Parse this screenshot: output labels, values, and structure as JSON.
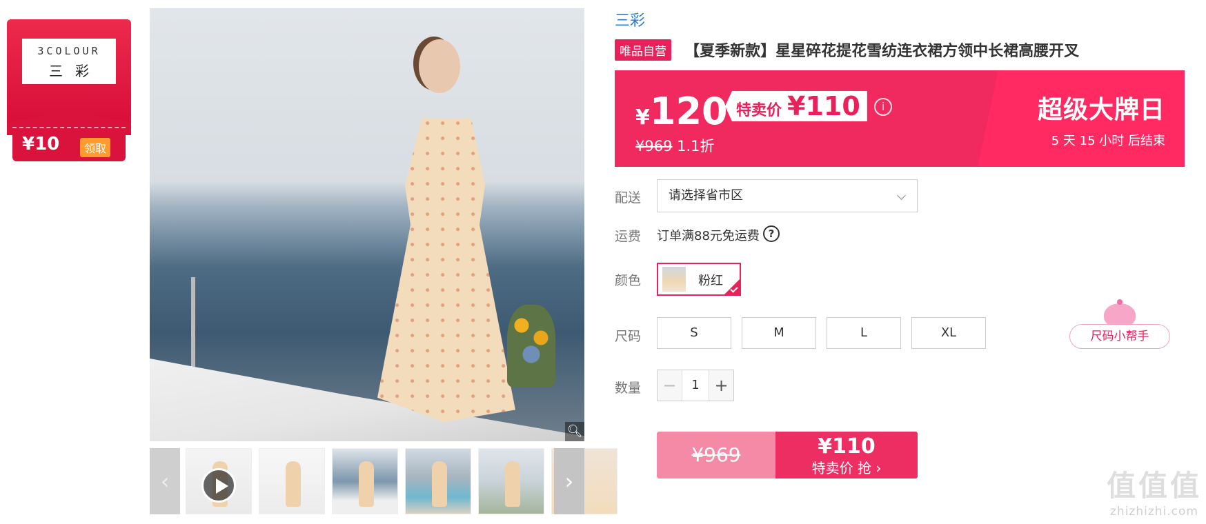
{
  "coupon": {
    "brand_en": "3COLOUR",
    "brand_cn": "三彩",
    "value": "¥10",
    "claim_label": "领取"
  },
  "gallery": {
    "zoom_icon": "magnifier-icon",
    "thumbnails": [
      "video",
      "photo",
      "photo",
      "photo",
      "photo",
      "photo"
    ],
    "prev_icon": "chevron-left-icon",
    "next_icon": "chevron-right-icon"
  },
  "product": {
    "brand": "三彩",
    "self_tag": "唯品自营",
    "title": "【夏季新款】星星碎花提花雪纺连衣裙方领中长裙高腰开叉"
  },
  "price": {
    "currency": "¥",
    "current": "120",
    "sale_label": "特卖价",
    "sale_value": "¥110",
    "original": "¥969",
    "discount": "1.1折",
    "event_title": "超级大牌日",
    "countdown": "5  天 15 小时 后结束",
    "accent_color": "#f0295f"
  },
  "delivery": {
    "label": "配送",
    "placeholder": "请选择省市区"
  },
  "shipping": {
    "label": "运费",
    "text": "订单满88元免运费"
  },
  "color": {
    "label": "颜色",
    "selected": "粉红"
  },
  "size": {
    "label": "尺码",
    "options": [
      "S",
      "M",
      "L",
      "XL"
    ],
    "helper": "尺码小帮手"
  },
  "quantity": {
    "label": "数量",
    "minus": "−",
    "value": "1",
    "plus": "+"
  },
  "buy": {
    "original": "¥969",
    "price": "¥110",
    "action": "特卖价 抢 ›"
  },
  "watermark": {
    "logo": "值值值",
    "url": "zhizhizhi.com"
  }
}
